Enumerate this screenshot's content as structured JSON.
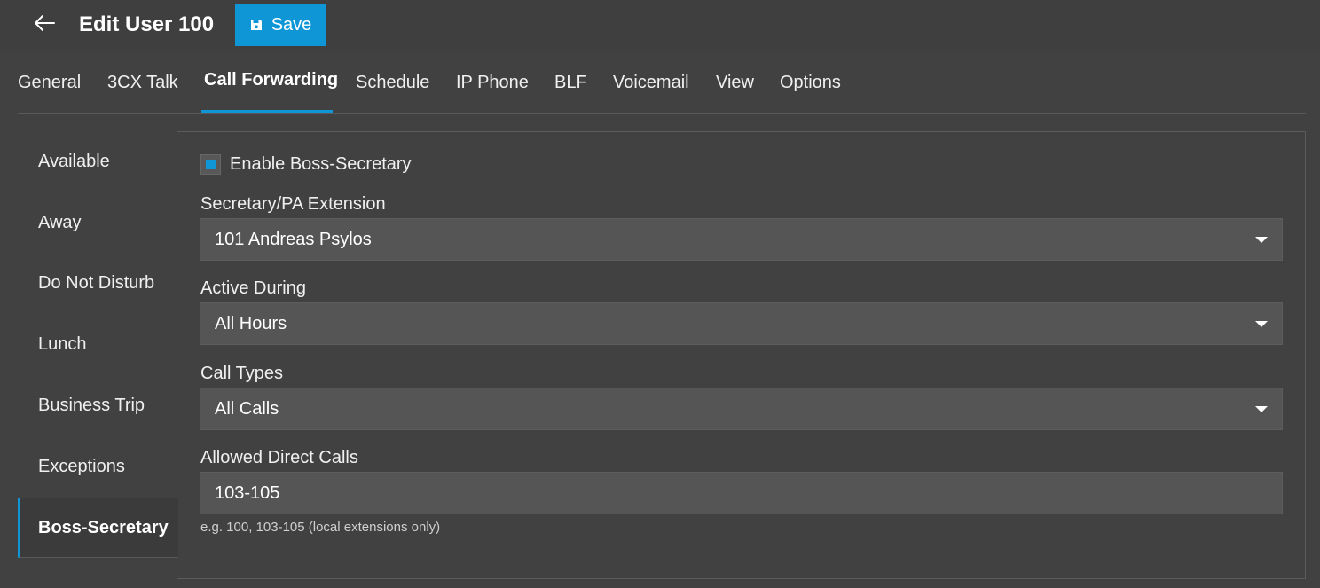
{
  "header": {
    "back_icon": "arrow-left-icon",
    "title": "Edit User 100",
    "save_label": "Save",
    "save_icon": "floppy-disk-icon",
    "accent_color": "#0f96d6"
  },
  "tabs": [
    {
      "label": "General"
    },
    {
      "label": "3CX Talk"
    },
    {
      "label": "Call Forwarding",
      "active": true
    },
    {
      "label": "Schedule"
    },
    {
      "label": "IP Phone"
    },
    {
      "label": "BLF"
    },
    {
      "label": "Voicemail"
    },
    {
      "label": "View"
    },
    {
      "label": "Options"
    }
  ],
  "side_nav": {
    "items": [
      {
        "label": "Available"
      },
      {
        "label": "Away"
      },
      {
        "label": "Do Not Disturb"
      },
      {
        "label": "Lunch"
      },
      {
        "label": "Business Trip"
      },
      {
        "label": "Exceptions"
      },
      {
        "label": "Boss-Secretary",
        "active": true
      }
    ]
  },
  "form": {
    "enable_label": "Enable Boss-Secretary",
    "enable_checked": true,
    "secretary_label": "Secretary/PA Extension",
    "secretary_value": "101 Andreas Psylos",
    "active_during_label": "Active During",
    "active_during_value": "All Hours",
    "call_types_label": "Call Types",
    "call_types_value": "All Calls",
    "allowed_label": "Allowed Direct Calls",
    "allowed_value": "103-105",
    "allowed_hint": "e.g. 100, 103-105 (local extensions only)"
  }
}
